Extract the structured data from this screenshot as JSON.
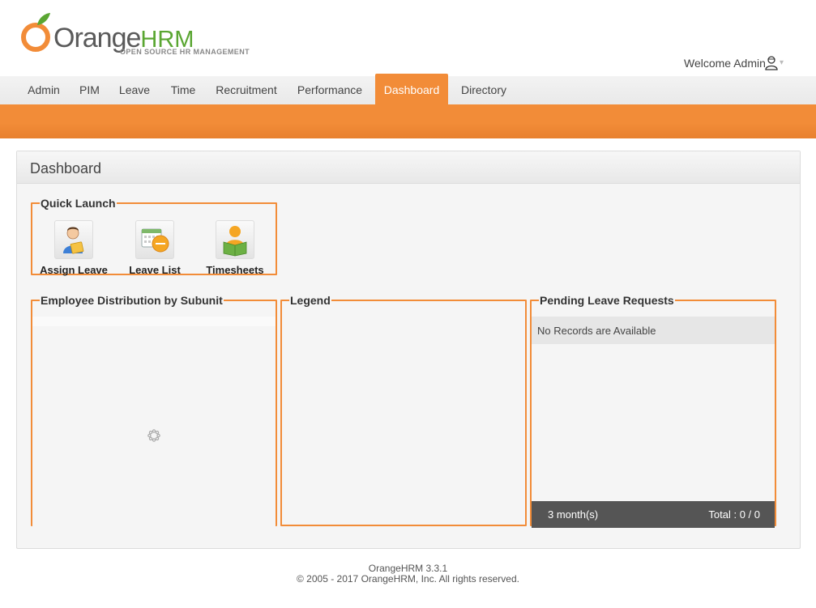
{
  "brand": {
    "logo_main": "Orange",
    "logo_accent": "HRM",
    "logo_tagline": "OPEN SOURCE HR MANAGEMENT",
    "colors": {
      "accent": "#f28c38",
      "brand_green": "#5aa632"
    }
  },
  "header": {
    "welcome_text": "Welcome Admin",
    "user_icon": "user-icon",
    "menu_caret": "▾"
  },
  "menu": {
    "items": [
      {
        "label": "Admin"
      },
      {
        "label": "PIM"
      },
      {
        "label": "Leave"
      },
      {
        "label": "Time"
      },
      {
        "label": "Recruitment"
      },
      {
        "label": "Performance"
      },
      {
        "label": "Dashboard",
        "active": true
      },
      {
        "label": "Directory"
      }
    ]
  },
  "dashboard": {
    "title": "Dashboard",
    "quick_launch": {
      "title": "Quick Launch",
      "items": [
        {
          "label": "Assign Leave",
          "icon": "assign-leave-icon"
        },
        {
          "label": "Leave List",
          "icon": "leave-list-icon"
        },
        {
          "label": "Timesheets",
          "icon": "timesheets-icon"
        }
      ]
    },
    "employee_distribution": {
      "title": "Employee Distribution by Subunit",
      "icon": "loading-spinner-icon"
    },
    "legend": {
      "title": "Legend"
    },
    "pending_leave": {
      "title": "Pending Leave Requests",
      "empty_message": "No Records are Available",
      "period": "3 month(s)",
      "total": "Total : 0 / 0"
    }
  },
  "footer": {
    "version": "OrangeHRM 3.3.1",
    "copyright_prefix": "© 2005 - 2017 ",
    "copyright_link": "OrangeHRM, Inc",
    "copyright_suffix": ". All rights reserved."
  }
}
